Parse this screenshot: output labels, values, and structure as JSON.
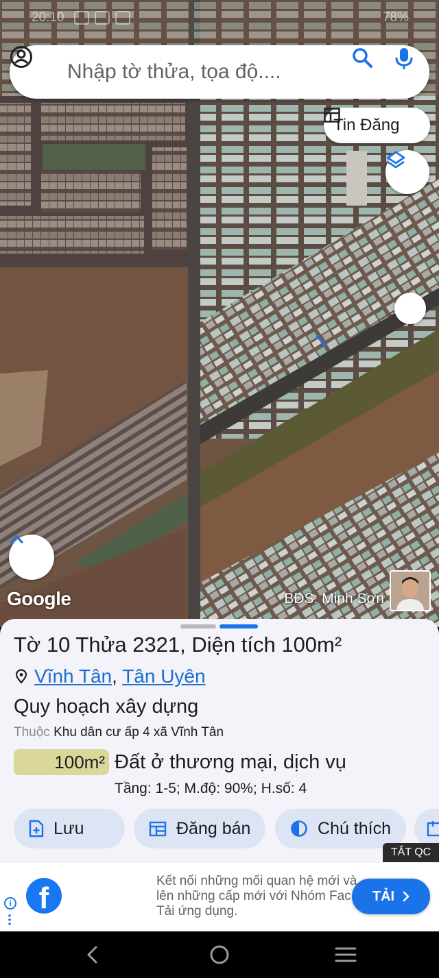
{
  "status_bar": {
    "time": "20:10",
    "battery": "78%"
  },
  "search": {
    "placeholder": "Nhập tờ thửa, tọa độ....",
    "value": ""
  },
  "map": {
    "tin_dang_label": "Tin Đăng",
    "google_label": "Google",
    "owner_label": "BĐS: Minh Sơn"
  },
  "parcel": {
    "title": "Tờ 10 Thửa 2321, Diện tích 100m²",
    "ward": "Vĩnh Tân",
    "separator": ",",
    "district": "Tân Uyên",
    "planning_heading": "Quy hoạch xây dựng",
    "belongs_prefix": "Thuộc",
    "belongs_to": "Khu dân cư ấp 4 xã Vĩnh Tân",
    "area_badge": "100m²",
    "land_use": "Đất ở thương mại, dịch vụ",
    "parameters": "Tầng: 1-5; M.độ: 90%; H.số: 4",
    "land_use_color": "#d9d89a"
  },
  "actions": {
    "save": "Lưu",
    "post_sale": "Đăng bán",
    "legend": "Chú thích"
  },
  "ad": {
    "close_label": "TẮT QC",
    "text": "Kết nối những mối quan hệ mới và lên những cấp mới với Nhóm Fac Tải ứng dụng.",
    "cta": "TẢI",
    "brand_icon": "facebook-icon"
  },
  "colors": {
    "accent": "#1a73e8",
    "chip_bg": "#dde5f4",
    "sheet_bg": "#f5f3fa"
  }
}
